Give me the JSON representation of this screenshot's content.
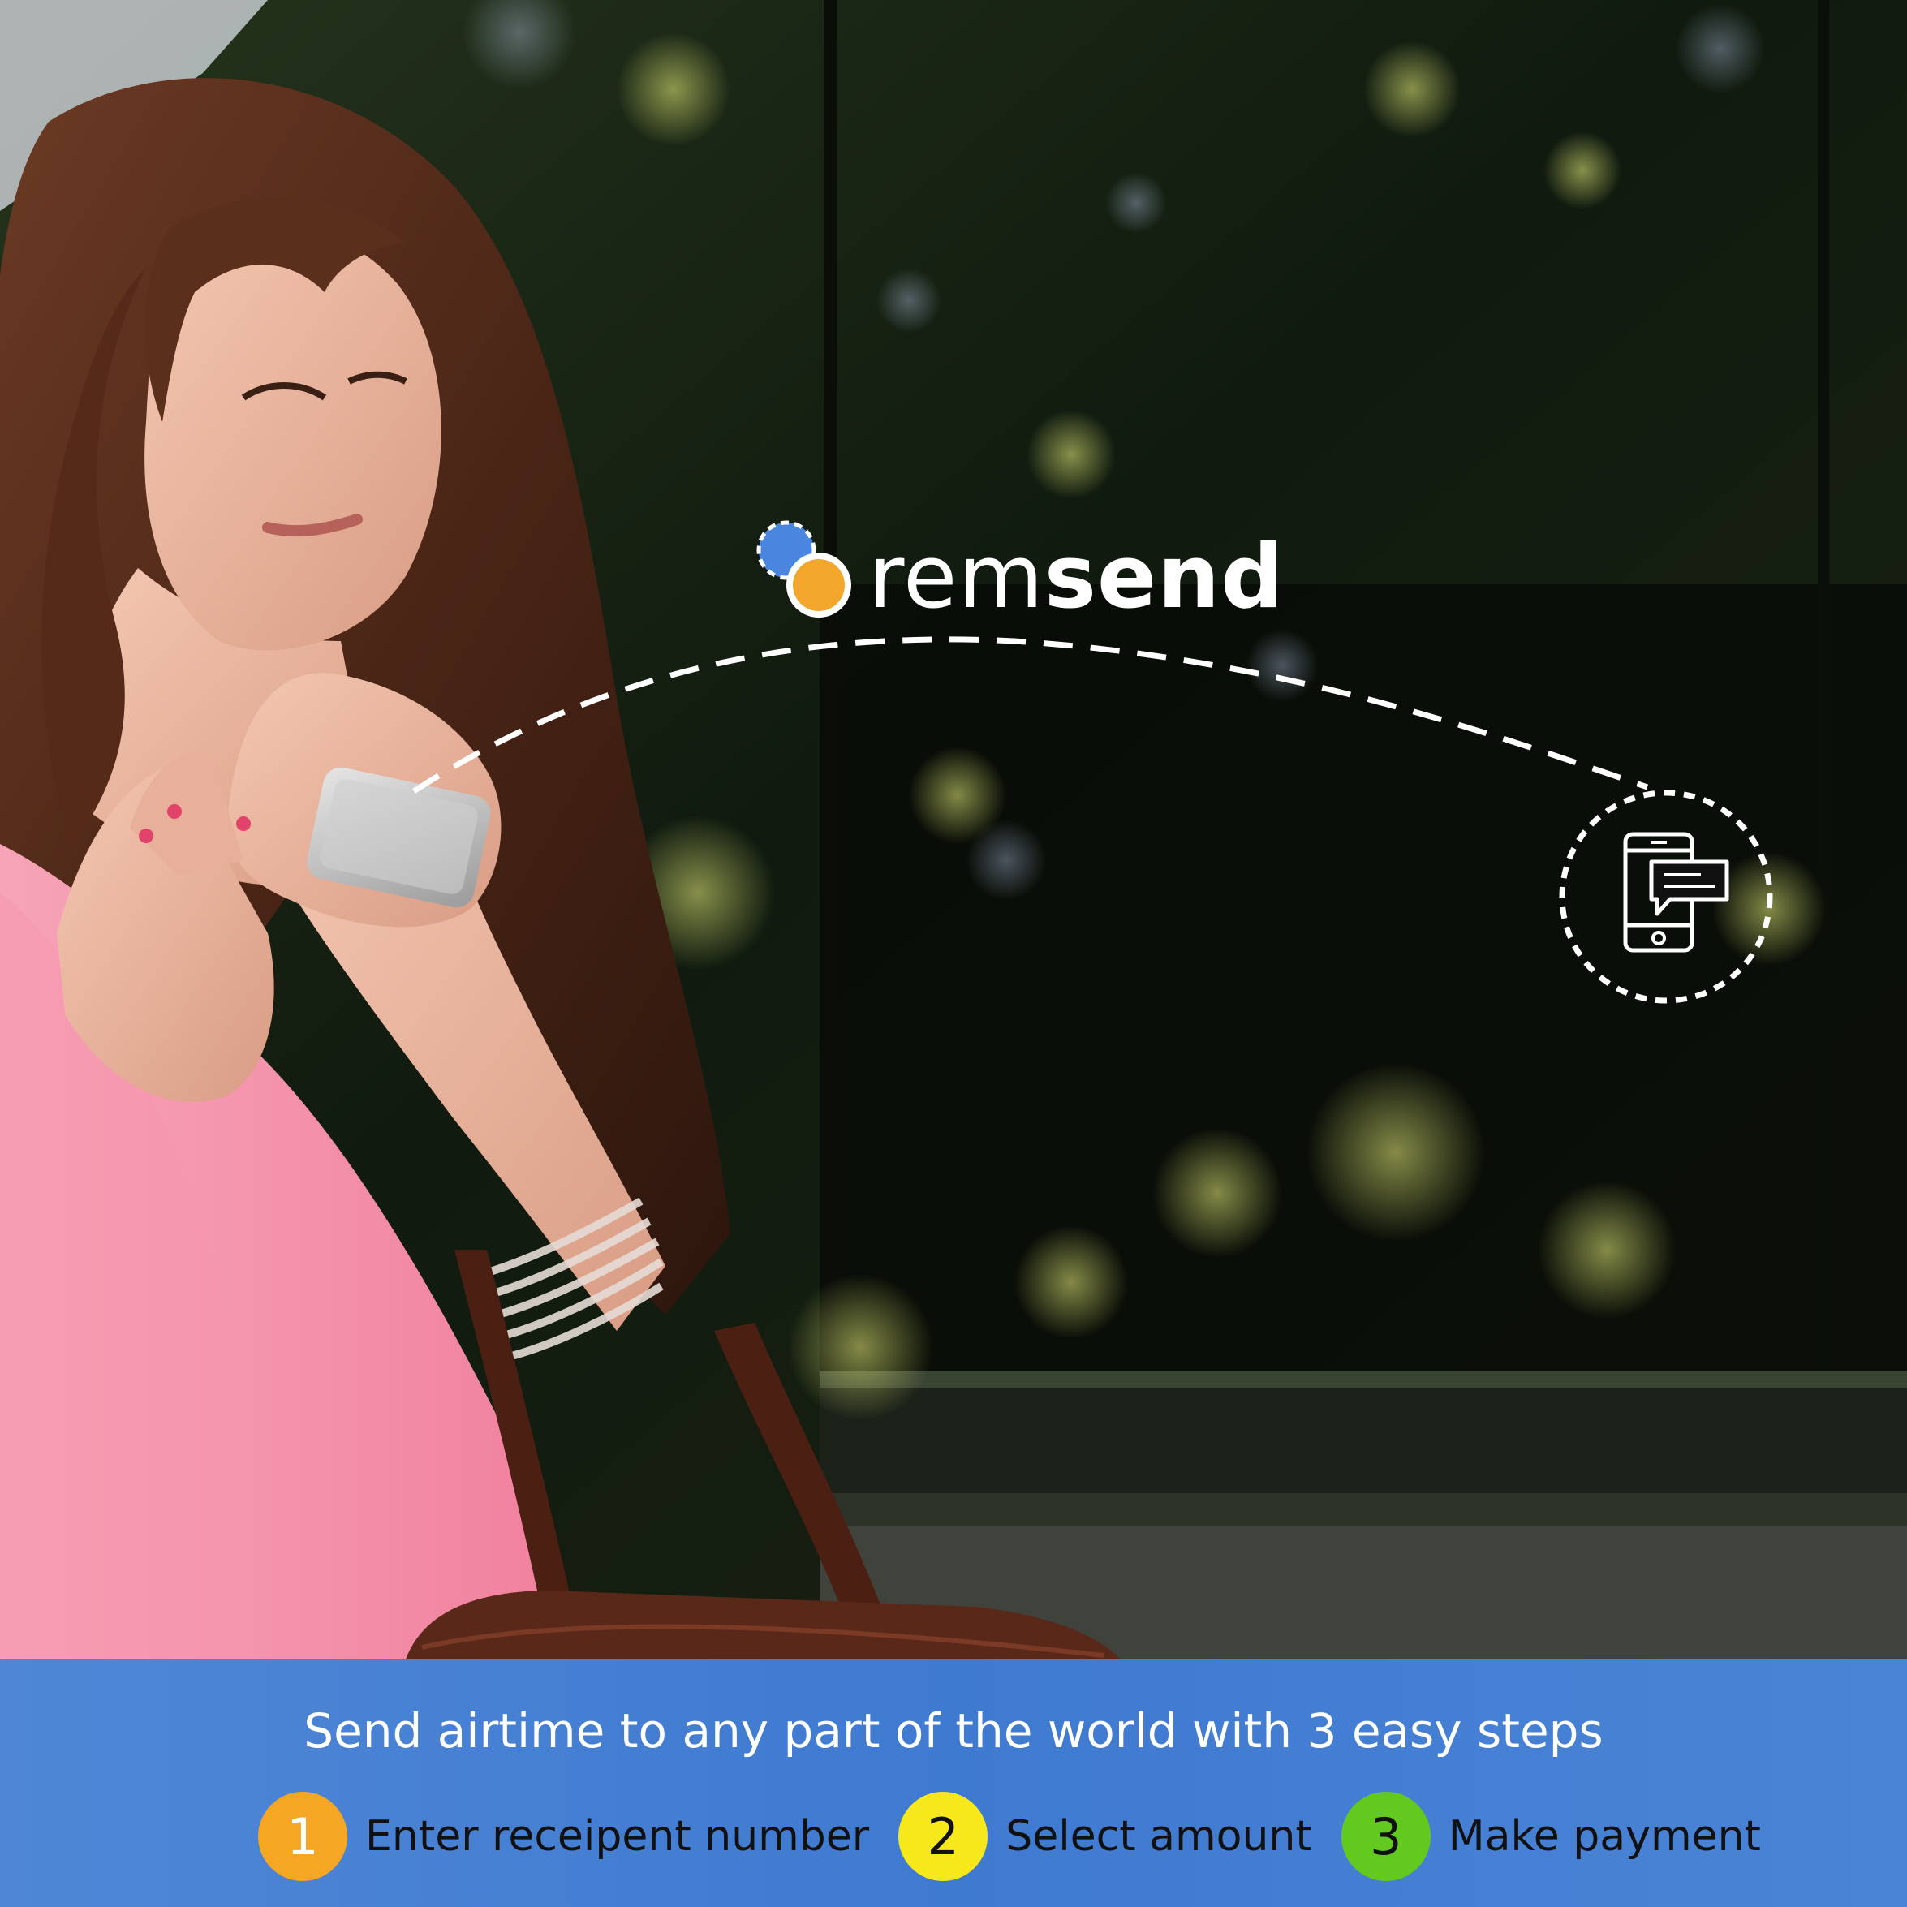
{
  "brand": {
    "name_light": "rem",
    "name_bold": "send",
    "dot_colors": {
      "blue": "#4a86e0",
      "orange": "#f2a62b"
    }
  },
  "icons": {
    "brand_mark": "brand-dots-icon",
    "sms": "mobile-message-icon"
  },
  "banner": {
    "title": "Send airtime to any part of the world with 3 easy steps",
    "background": "#4680d5"
  },
  "steps": [
    {
      "number": "1",
      "label": "Enter receipent number",
      "color": "#f5a623",
      "text_color": "#ffffff"
    },
    {
      "number": "2",
      "label": "Select amount",
      "color": "#f7e81c",
      "text_color": "#111111"
    },
    {
      "number": "3",
      "label": "Make payment",
      "color": "#62c91f",
      "text_color": "#111111"
    }
  ]
}
